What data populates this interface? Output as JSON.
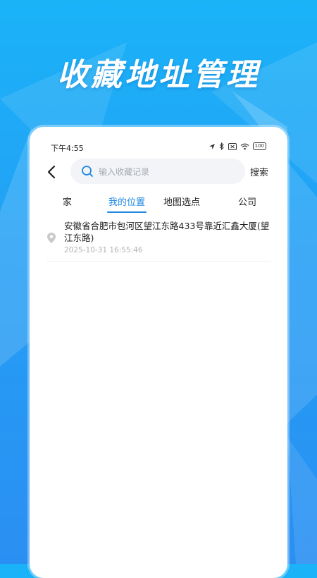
{
  "promo": {
    "title": "收藏地址管理"
  },
  "status_bar": {
    "time": "下午4:55",
    "battery": "100",
    "icons": [
      "location-arrow-icon",
      "bluetooth-icon",
      "sim-off-icon",
      "wifi-icon",
      "battery-icon"
    ]
  },
  "nav": {
    "search_placeholder": "输入收藏记录",
    "search_button": "搜索"
  },
  "tabs": [
    {
      "label": "家",
      "active": false
    },
    {
      "label": "我的位置",
      "active": true
    },
    {
      "label": "地图选点",
      "active": false
    },
    {
      "label": "公司",
      "active": false
    }
  ],
  "list": [
    {
      "address": "安徽省合肥市包河区望江东路433号靠近汇鑫大厦(望江东路)",
      "time": "2025-10-31 16:55:46"
    }
  ],
  "colors": {
    "accent": "#1e88e5",
    "background_top": "#1ab3f8",
    "background_bottom": "#2a8ff2",
    "search_bg": "#f2f4f7",
    "muted_text": "#b3b3b3"
  }
}
